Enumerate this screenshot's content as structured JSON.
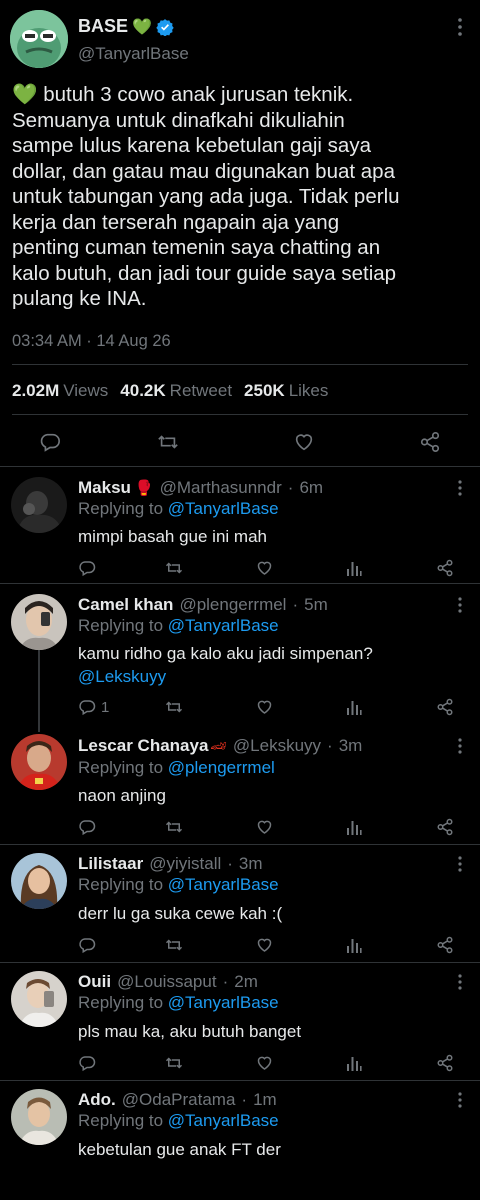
{
  "main_tweet": {
    "author_name": "BASE",
    "name_emoji": "💚",
    "handle": "@TanyarlBase",
    "text": "💚 butuh 3 cowo anak jurusan teknik.\nSemuanya untuk dinafkahi dikuliahin\nsampe lulus karena kebetulan gaji saya\ndollar, dan gatau mau digunakan buat apa\nuntuk tabungan yang ada juga. Tidak perlu\nkerja dan terserah ngapain aja yang\npenting cuman temenin saya chatting an\nkalo butuh, dan jadi tour guide saya setiap\npulang ke INA.",
    "time": "03:34 AM · 14 Aug 26",
    "views_count": "2.02M",
    "views_label": "Views",
    "retweet_count": "40.2K",
    "retweet_label": "Retweet",
    "likes_count": "250K",
    "likes_label": "Likes"
  },
  "replies": [
    {
      "name": "Maksu",
      "name_emoji": "🥊",
      "handle": "@Marthasunndr",
      "time": "6m",
      "replying_prefix": "Replying to",
      "replying_to": "@TanyarlBase",
      "text": "mimpi basah gue ini mah",
      "reply_count": ""
    },
    {
      "name": "Camel khan",
      "name_emoji": "",
      "handle": "@plengerrmel",
      "time": "5m",
      "replying_prefix": "Replying to",
      "replying_to": "@TanyarlBase",
      "text": "kamu ridho ga kalo aku jadi simpenan?",
      "mention": "@Lekskuyy",
      "reply_count": "1"
    },
    {
      "name": "Lescar Chanaya",
      "name_emoji": "🏎",
      "handle": "@Lekskuyy",
      "time": "3m",
      "replying_prefix": "Replying to",
      "replying_to": "@plengerrmel",
      "text": "naon anjing",
      "reply_count": ""
    },
    {
      "name": "Lilistaar",
      "name_emoji": "",
      "handle": "@yiyistall",
      "time": "3m",
      "replying_prefix": "Replying to",
      "replying_to": "@TanyarlBase",
      "text": "derr lu ga suka cewe kah :(",
      "reply_count": ""
    },
    {
      "name": "Ouii",
      "name_emoji": "",
      "handle": "@Louissaput",
      "time": "2m",
      "replying_prefix": "Replying to",
      "replying_to": "@TanyarlBase",
      "text": "pls mau ka, aku butuh banget",
      "reply_count": ""
    },
    {
      "name": "Ado.",
      "name_emoji": "",
      "handle": "@OdaPratama",
      "time": "1m",
      "replying_prefix": "Replying to",
      "replying_to": "@TanyarlBase",
      "text": "kebetulan gue anak FT der",
      "reply_count": ""
    }
  ],
  "dot_separator": "·",
  "colors": {
    "background": "#000000",
    "text": "#e7e9ea",
    "muted": "#71767b",
    "link": "#1d9bf0",
    "divider": "#2f3336"
  }
}
